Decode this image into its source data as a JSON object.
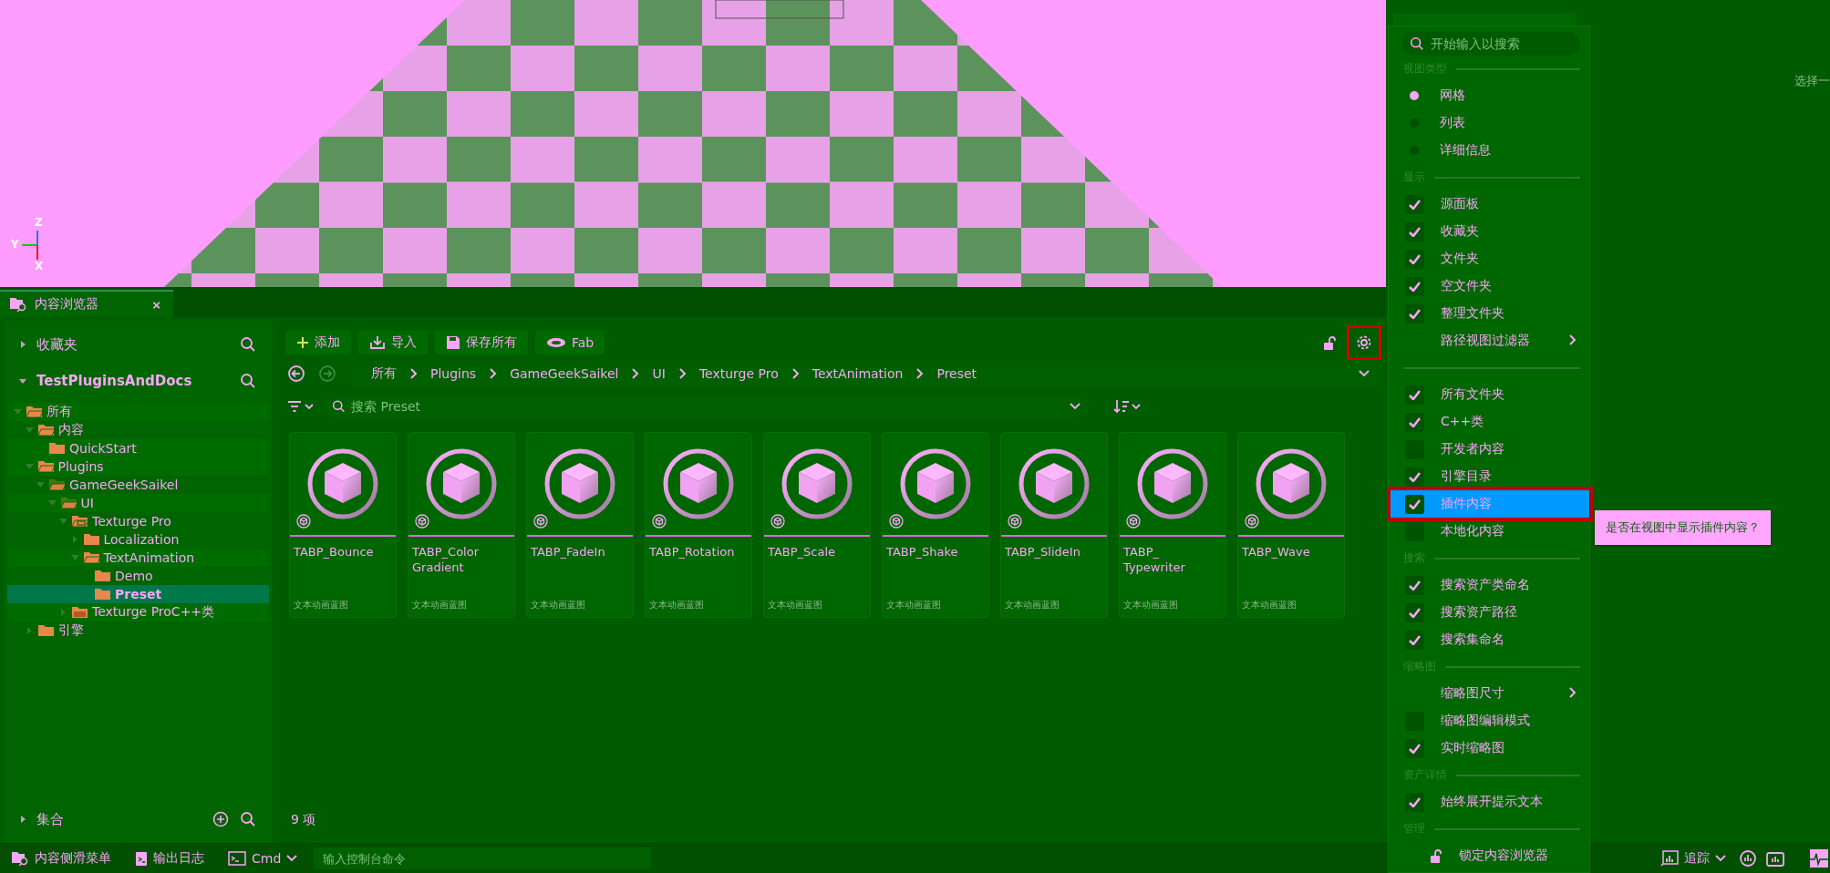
{
  "viewport": {
    "axes": [
      "Z",
      "Y",
      "X"
    ]
  },
  "details_panel": {
    "hint": "选择一"
  },
  "content_browser_tab": {
    "title": "内容浏览器",
    "close": "×"
  },
  "sources": {
    "favorites": {
      "label": "收藏夹",
      "expanded": false
    },
    "project": {
      "label": "TestPluginsAndDocs",
      "expanded": true
    },
    "tree": [
      {
        "label": "所有",
        "kind": "folder",
        "expanded": true,
        "selected": false,
        "children": [
          {
            "label": "内容",
            "kind": "folder",
            "expanded": true,
            "selected": false,
            "children": [
              {
                "label": "QuickStart",
                "kind": "folder",
                "selected": false
              }
            ]
          },
          {
            "label": "Plugins",
            "kind": "folder",
            "expanded": true,
            "selected": false,
            "children": [
              {
                "label": "GameGeekSaikel",
                "kind": "plugin",
                "expanded": true,
                "selected": false,
                "children": [
                  {
                    "label": "UI",
                    "kind": "plugin",
                    "expanded": true,
                    "selected": false,
                    "children": [
                      {
                        "label": "Texturge Pro",
                        "kind": "module",
                        "expanded": true,
                        "selected": false,
                        "children": [
                          {
                            "label": "Localization",
                            "kind": "folder",
                            "expanded": false,
                            "selected": false
                          },
                          {
                            "label": "TextAnimation",
                            "kind": "folder",
                            "expanded": true,
                            "selected": false,
                            "children": [
                              {
                                "label": "Demo",
                                "kind": "folder",
                                "selected": false
                              },
                              {
                                "label": "Preset",
                                "kind": "folder",
                                "selected": true
                              }
                            ]
                          }
                        ]
                      },
                      {
                        "label": "Texturge ProC++类",
                        "kind": "cpp",
                        "expanded": false,
                        "selected": false
                      }
                    ]
                  }
                ]
              }
            ]
          },
          {
            "label": "引擎",
            "kind": "folder",
            "expanded": false,
            "selected": false
          }
        ]
      }
    ],
    "collections": {
      "label": "集合",
      "expanded": false
    }
  },
  "toolbar": {
    "buttons": [
      {
        "label": "添加",
        "kind": "add"
      },
      {
        "label": "导入",
        "kind": "import"
      },
      {
        "label": "保存所有",
        "kind": "save"
      },
      {
        "label": "Fab",
        "kind": "fab"
      }
    ],
    "settings_annotated": true
  },
  "breadcrumb": [
    "所有",
    "Plugins",
    "GameGeekSaikel",
    "UI",
    "Texturge Pro",
    "TextAnimation",
    "Preset"
  ],
  "search": {
    "placeholder": "搜索 Preset"
  },
  "assets": [
    {
      "name": "TABP_Bounce",
      "type": "文本动画蓝图"
    },
    {
      "name": "TABP_Color Gradient",
      "type": "文本动画蓝图"
    },
    {
      "name": "TABP_FadeIn",
      "type": "文本动画蓝图"
    },
    {
      "name": "TABP_Rotation",
      "type": "文本动画蓝图"
    },
    {
      "name": "TABP_Scale",
      "type": "文本动画蓝图"
    },
    {
      "name": "TABP_Shake",
      "type": "文本动画蓝图"
    },
    {
      "name": "TABP_SlideIn",
      "type": "文本动画蓝图"
    },
    {
      "name": "TABP_ Typewriter",
      "type": "文本动画蓝图"
    },
    {
      "name": "TABP_Wave",
      "type": "文本动画蓝图"
    }
  ],
  "item_count": "9 项",
  "settings_menu": {
    "search_placeholder": "开始输入以搜索",
    "sections": [
      {
        "title": "视图类型",
        "items": [
          {
            "kind": "radio",
            "label": "网格",
            "selected": true
          },
          {
            "kind": "radio",
            "label": "列表",
            "selected": false
          },
          {
            "kind": "radio",
            "label": "详细信息",
            "selected": false
          }
        ]
      },
      {
        "title": "显示",
        "items": [
          {
            "kind": "check",
            "label": "源面板",
            "checked": true
          },
          {
            "kind": "check",
            "label": "收藏夹",
            "checked": true
          },
          {
            "kind": "check",
            "label": "文件夹",
            "checked": true
          },
          {
            "kind": "check",
            "label": "空文件夹",
            "checked": true
          },
          {
            "kind": "check",
            "label": "整理文件夹",
            "checked": true
          },
          {
            "kind": "submenu",
            "label": "路径视图过滤器"
          }
        ]
      },
      {
        "items": [
          {
            "kind": "check",
            "label": "所有文件夹",
            "checked": true
          },
          {
            "kind": "check",
            "label": "C++类",
            "checked": true
          },
          {
            "kind": "check",
            "label": "开发者内容",
            "checked": false
          },
          {
            "kind": "check",
            "label": "引擎目录",
            "checked": true
          },
          {
            "kind": "check",
            "label": "插件内容",
            "checked": true,
            "highlighted": true,
            "annotated": true
          },
          {
            "kind": "check",
            "label": "本地化内容",
            "checked": false
          }
        ]
      },
      {
        "title": "搜索",
        "items": [
          {
            "kind": "check",
            "label": "搜索资产类命名",
            "checked": true
          },
          {
            "kind": "check",
            "label": "搜索资产路径",
            "checked": true
          },
          {
            "kind": "check",
            "label": "搜索集命名",
            "checked": true
          }
        ]
      },
      {
        "title": "缩略图",
        "items": [
          {
            "kind": "submenu",
            "label": "缩略图尺寸"
          },
          {
            "kind": "check",
            "label": "缩略图编辑模式",
            "checked": false
          },
          {
            "kind": "check",
            "label": "实时缩略图",
            "checked": true
          }
        ]
      },
      {
        "title": "资产详情",
        "items": [
          {
            "kind": "check",
            "label": "始终展开提示文本",
            "checked": true
          }
        ]
      },
      {
        "title": "管理",
        "items": [
          {
            "kind": "lock",
            "label": "锁定内容浏览器"
          }
        ]
      }
    ]
  },
  "tooltip": "是否在视图中显示插件内容？",
  "status_bar": {
    "content_drawer": "内容侧滑菜单",
    "output_log": "输出日志",
    "cmd": "Cmd",
    "console_placeholder": "输入控制台命令",
    "trace": "追踪"
  }
}
